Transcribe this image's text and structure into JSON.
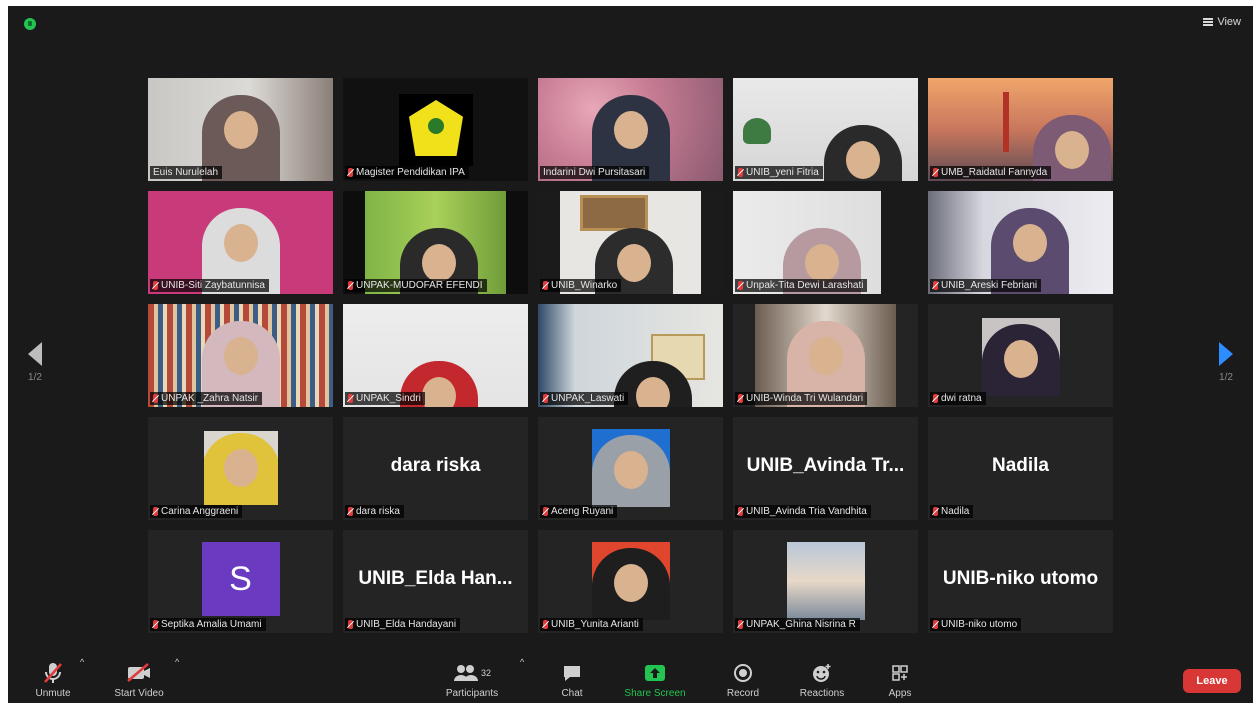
{
  "meeting": {
    "view_label": "View"
  },
  "pagination": {
    "prev_label": "1/2",
    "next_label": "1/2"
  },
  "participants": [
    {
      "name": "Euis Nurulelah",
      "display": ""
    },
    {
      "name": "Magister Pendidikan IPA",
      "display": ""
    },
    {
      "name": "Indarini Dwi Pursitasari",
      "display": ""
    },
    {
      "name": "UNIB_yeni Fitria",
      "display": ""
    },
    {
      "name": "UMB_Raidatul Fannyda",
      "display": ""
    },
    {
      "name": "UNIB-Siti Zaybatunnisa",
      "display": ""
    },
    {
      "name": "UNPAK-MUDOFAR EFENDI",
      "display": ""
    },
    {
      "name": "UNIB_Winarko",
      "display": ""
    },
    {
      "name": "Unpak-Tita Dewi Larashati",
      "display": ""
    },
    {
      "name": "UNIB_Areski Febriani",
      "display": ""
    },
    {
      "name": "UNPAK _Zahra Natsir",
      "display": ""
    },
    {
      "name": "UNPAK_Sindri",
      "display": ""
    },
    {
      "name": "UNPAK_Laswati",
      "display": ""
    },
    {
      "name": "UNIB-Winda Tri Wulandari",
      "display": ""
    },
    {
      "name": "dwi ratna",
      "display": ""
    },
    {
      "name": "Carina Anggraeni",
      "display": ""
    },
    {
      "name": "dara riska",
      "display": "dara riska"
    },
    {
      "name": "Aceng Ruyani",
      "display": ""
    },
    {
      "name": "UNIB_Avinda Tria Vandhita",
      "display": "UNIB_Avinda Tr..."
    },
    {
      "name": "Nadila",
      "display": "Nadila"
    },
    {
      "name": "Septika Amalia Umami",
      "display": "S"
    },
    {
      "name": "UNIB_Elda Handayani",
      "display": "UNIB_Elda Han..."
    },
    {
      "name": "UNIB_Yunita Arianti",
      "display": ""
    },
    {
      "name": "UNPAK_Ghina Nisrina R",
      "display": ""
    },
    {
      "name": "UNIB-niko utomo",
      "display": "UNIB-niko utomo"
    }
  ],
  "toolbar": {
    "unmute": "Unmute",
    "start_video": "Start Video",
    "participants": "Participants",
    "participant_count": "32",
    "chat": "Chat",
    "share_screen": "Share Screen",
    "record": "Record",
    "reactions": "Reactions",
    "apps": "Apps",
    "leave": "Leave"
  },
  "colors": {
    "background": "#1a1a1a",
    "tile": "#242424",
    "active_speaker": "#c6e25a",
    "share_green": "#23c552",
    "leave_red": "#d93636",
    "next_arrow": "#2d8cff"
  }
}
